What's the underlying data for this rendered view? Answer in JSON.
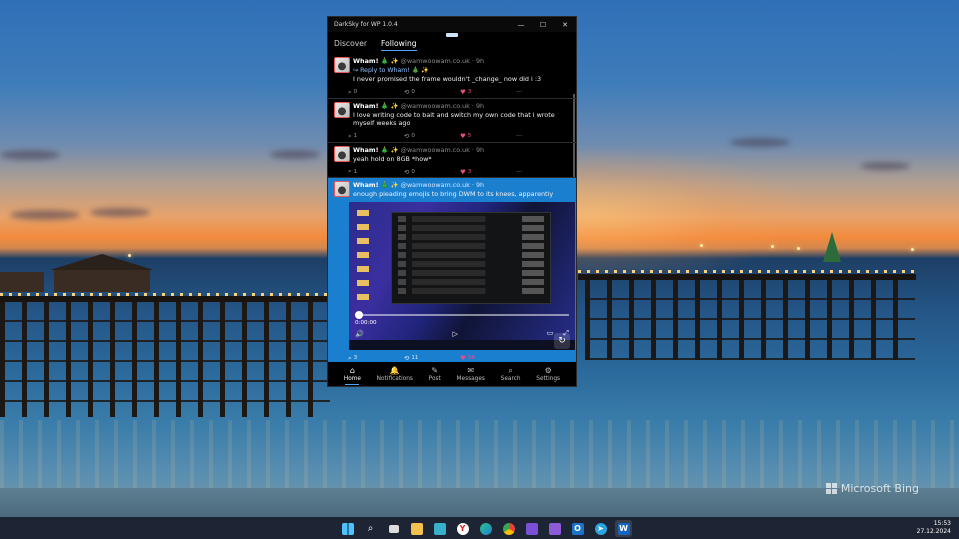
{
  "window": {
    "title": "DarkSky for WP 1.0.4",
    "controls": {
      "minimize": "—",
      "maximize": "☐",
      "close": "✕"
    }
  },
  "tabs": [
    {
      "label": "Discover",
      "active": false
    },
    {
      "label": "Following",
      "active": true
    }
  ],
  "posts": [
    {
      "name": "Wham!",
      "emoji": "🎄 ✨",
      "handle": "@wamwoowam.co.uk · 9h",
      "reply_to": "↪ Reply to Wham! 🎄 ✨",
      "text": "I never promised the frame wouldn't _change_ now did i :3",
      "replies": "0",
      "reposts": "0",
      "likes": "3"
    },
    {
      "name": "Wham!",
      "emoji": "🎄 ✨",
      "handle": "@wamwoowam.co.uk · 9h",
      "text": "I love writing code to bait and switch my own code that i wrote myself weeks ago",
      "replies": "1",
      "reposts": "0",
      "likes": "5"
    },
    {
      "name": "Wham!",
      "emoji": "🎄 ✨",
      "handle": "@wamwoowam.co.uk · 9h",
      "text": "yeah hold on 8GB *how*",
      "replies": "1",
      "reposts": "0",
      "likes": "3"
    },
    {
      "name": "Wham!",
      "emoji": "🎄 ✨",
      "handle": "@wamwoowam.co.uk · 9h",
      "text": "enough pleading emojis to bring DWM to its knees, apparently",
      "media_time": "0:00:00",
      "replies": "3",
      "reposts": "11",
      "likes": "58"
    }
  ],
  "bottom_nav": [
    {
      "label": "Home",
      "icon": "home-icon",
      "active": true
    },
    {
      "label": "Notifications",
      "icon": "bell-icon",
      "active": false
    },
    {
      "label": "Post",
      "icon": "pencil-icon",
      "active": false
    },
    {
      "label": "Messages",
      "icon": "mail-icon",
      "active": false
    },
    {
      "label": "Search",
      "icon": "search-icon",
      "active": false
    },
    {
      "label": "Settings",
      "icon": "gear-icon",
      "active": false
    }
  ],
  "desktop": {
    "watermark": "Microsoft Bing"
  },
  "taskbar": {
    "icons": [
      "windows-start-icon",
      "search-icon",
      "task-view-icon",
      "file-explorer-icon",
      "notepad-icon",
      "yandex-browser-icon",
      "edge-icon",
      "chrome-icon",
      "floppy-disk-icon",
      "visual-studio-icon",
      "outlook-icon",
      "telegram-icon",
      "darksky-app-icon"
    ],
    "time": "15:53",
    "date": "27.12.2024"
  },
  "colors": {
    "accent": "#1b7fd0",
    "like": "#e84a8a",
    "taskbar": "#1d2433"
  }
}
